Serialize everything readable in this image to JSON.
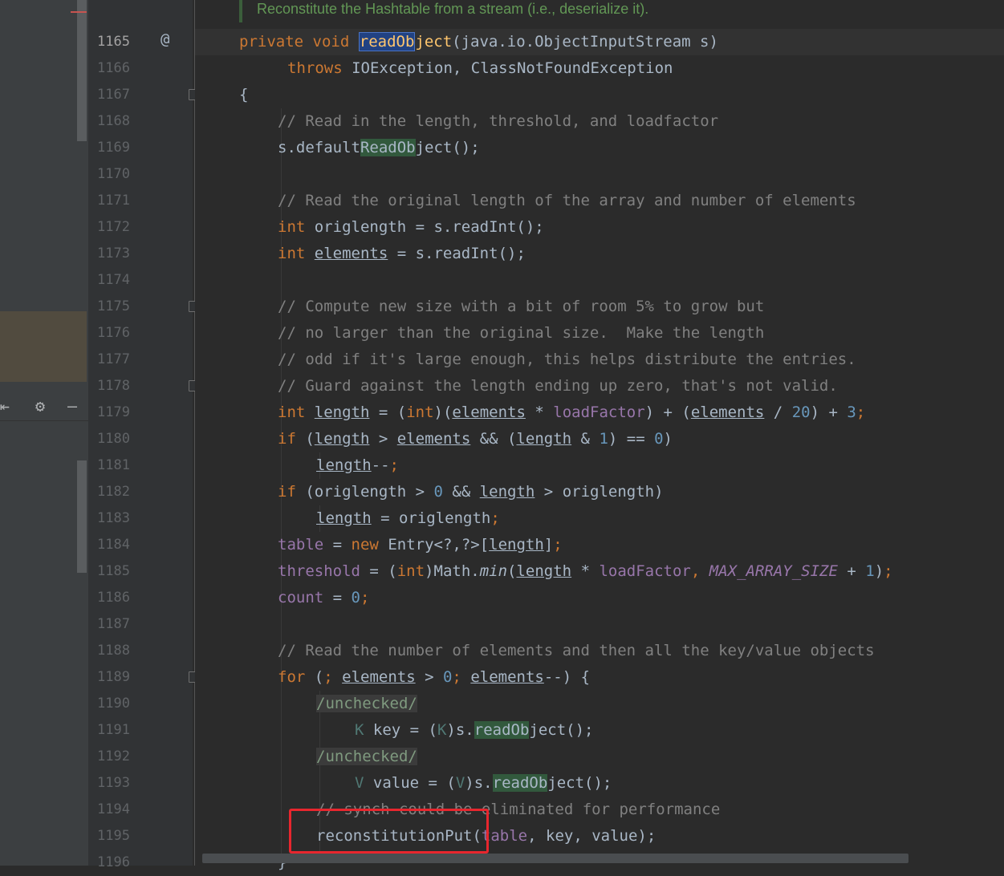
{
  "doc_comment": "Reconstitute the Hashtable from a stream (i.e., deserialize it).",
  "gutter_marker": "@",
  "line_numbers": [
    "1165",
    "1166",
    "1167",
    "1168",
    "1169",
    "1170",
    "1171",
    "1172",
    "1173",
    "1174",
    "1175",
    "1176",
    "1177",
    "1178",
    "1179",
    "1180",
    "1181",
    "1182",
    "1183",
    "1184",
    "1185",
    "1186",
    "1187",
    "1188",
    "1189",
    "1190",
    "1191",
    "1192",
    "1193",
    "1194",
    "1195",
    "1196"
  ],
  "code": {
    "private": "private",
    "void": "void",
    "readObject_sel": "readOb",
    "readObject_rest": "ject",
    "sig_rest": "(java.io.ObjectInputStream s)",
    "throws": "throws",
    "exc": "IOException, ClassNotFoundException",
    "brace_open": "{",
    "c1": "// Read in the length, threshold, and loadfactor",
    "dro_pre": "s.default",
    "dro_hl": "ReadOb",
    "dro_post": "ject();",
    "c2": "// Read the original length of the array and number of elements",
    "int": "int",
    "l1172": " origlength = s.readInt();",
    "elements": "elements",
    "l1173_post": " = s.readInt();",
    "c3": "// Compute new size with a bit of room 5% to grow but",
    "c4": "// no larger than the original size.  Make the length",
    "c5": "// odd if it's large enough, this helps distribute the entries.",
    "c6": "// Guard against the length ending up zero, that's not valid.",
    "length": "length",
    "loadFactor": "loadFactor",
    "if": "if",
    "for": "for",
    "new": "new",
    "table": "table",
    "threshold": "threshold",
    "count": "count",
    "max_array_size": "MAX_ARRAY_SIZE",
    "min": "min",
    "n20": "20",
    "n3": "3",
    "n1": "1",
    "n0": "0",
    "origlength": "origlength",
    "entry": "Entry<?,?>[",
    "math": "Math.",
    "c7": "// Read the number of elements and then all the key/value objects",
    "unchecked": "/unchecked/",
    "K": "K",
    "V": "V",
    "key_decl": " key = (",
    "value_decl": " value = (",
    "s_dot": ")s.",
    "ro_hl": "readOb",
    "ro_post": "ject();",
    "c8": "// synch could be eliminated for performance",
    "reconstitution": "reconstitutionPut",
    "recon_args_table": "table",
    "recon_args_rest": ", key, value);",
    "close_brace": "}"
  }
}
